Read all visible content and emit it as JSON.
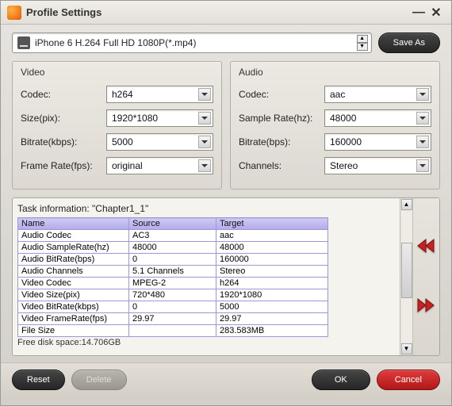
{
  "window": {
    "title": "Profile Settings"
  },
  "profile": {
    "selected": "iPhone 6 H.264 Full HD 1080P(*.mp4)",
    "save_as_label": "Save As"
  },
  "video": {
    "title": "Video",
    "codec_label": "Codec:",
    "codec_value": "h264",
    "size_label": "Size(pix):",
    "size_value": "1920*1080",
    "bitrate_label": "Bitrate(kbps):",
    "bitrate_value": "5000",
    "framerate_label": "Frame Rate(fps):",
    "framerate_value": "original"
  },
  "audio": {
    "title": "Audio",
    "codec_label": "Codec:",
    "codec_value": "aac",
    "samplerate_label": "Sample Rate(hz):",
    "samplerate_value": "48000",
    "bitrate_label": "Bitrate(bps):",
    "bitrate_value": "160000",
    "channels_label": "Channels:",
    "channels_value": "Stereo"
  },
  "task": {
    "title": "Task information: \"Chapter1_1\"",
    "headers": {
      "name": "Name",
      "source": "Source",
      "target": "Target"
    },
    "rows": [
      {
        "name": "Audio Codec",
        "source": "AC3",
        "target": "aac"
      },
      {
        "name": "Audio SampleRate(hz)",
        "source": "48000",
        "target": "48000"
      },
      {
        "name": "Audio BitRate(bps)",
        "source": "0",
        "target": "160000"
      },
      {
        "name": "Audio Channels",
        "source": "5.1 Channels",
        "target": "Stereo"
      },
      {
        "name": "Video Codec",
        "source": "MPEG-2",
        "target": "h264"
      },
      {
        "name": "Video Size(pix)",
        "source": "720*480",
        "target": "1920*1080"
      },
      {
        "name": "Video BitRate(kbps)",
        "source": "0",
        "target": "5000"
      },
      {
        "name": "Video FrameRate(fps)",
        "source": "29.97",
        "target": "29.97"
      },
      {
        "name": "File Size",
        "source": "",
        "target": "283.583MB"
      }
    ],
    "free_disk": "Free disk space:14.706GB"
  },
  "footer": {
    "reset_label": "Reset",
    "delete_label": "Delete",
    "ok_label": "OK",
    "cancel_label": "Cancel"
  }
}
